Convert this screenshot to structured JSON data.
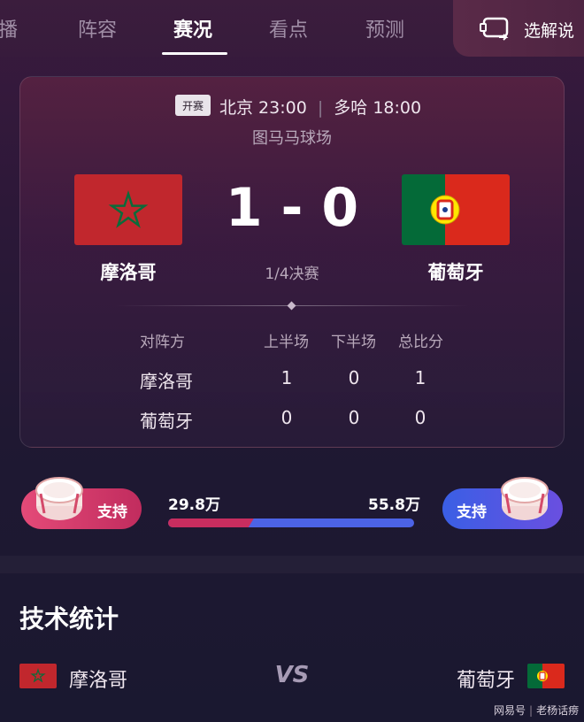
{
  "tabs": [
    {
      "label": "播"
    },
    {
      "label": "阵容"
    },
    {
      "label": "赛况"
    },
    {
      "label": "看点"
    },
    {
      "label": "预测"
    }
  ],
  "commentary_button": {
    "label": "选解说",
    "icon": "commentary-switch-icon"
  },
  "match": {
    "badge": "开赛",
    "beijing_time": "北京 23:00",
    "doha_time": "多哈 18:00",
    "venue": "图马马球场",
    "home_team": "摩洛哥",
    "away_team": "葡萄牙",
    "score": "1 - 0",
    "round": "1/4决赛"
  },
  "score_table": {
    "headers": [
      "对阵方",
      "上半场",
      "下半场",
      "总比分"
    ],
    "rows": [
      {
        "team": "摩洛哥",
        "first_half": "1",
        "second_half": "0",
        "total": "1"
      },
      {
        "team": "葡萄牙",
        "first_half": "0",
        "second_half": "0",
        "total": "0"
      }
    ]
  },
  "support": {
    "home_label": "支持",
    "away_label": "支持",
    "home_votes": "29.8万",
    "away_votes": "55.8万",
    "home_share": 0.348,
    "home_color": "#c82d5f",
    "away_color": "#4c63e6"
  },
  "stats": {
    "title": "技术统计",
    "home_team": "摩洛哥",
    "away_team": "葡萄牙",
    "vs": "VS"
  },
  "watermark": {
    "source": "网易号",
    "author": "老杨话痨"
  }
}
